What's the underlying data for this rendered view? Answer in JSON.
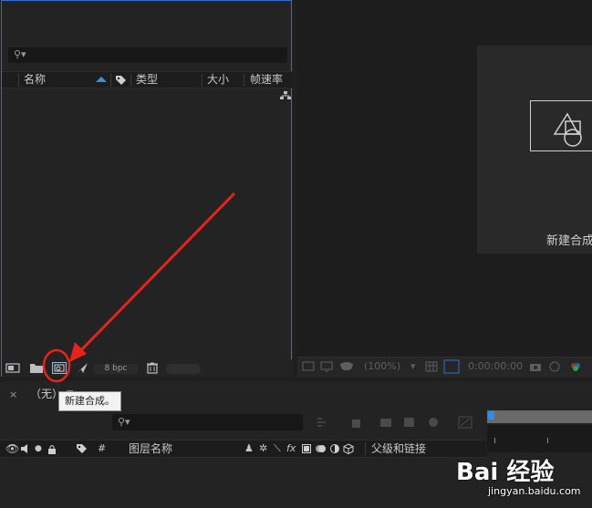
{
  "project_panel": {
    "columns": {
      "name": "名称",
      "type": "类型",
      "size": "大小",
      "frame_rate": "帧速率"
    },
    "footer": {
      "bpc": "8 bpc",
      "buttons": [
        "interpret-footage-icon",
        "new-folder-icon",
        "new-composition-icon",
        "render-queue-icon",
        "trash-icon"
      ]
    }
  },
  "viewer": {
    "placeholder_label": "新建合成",
    "zoom": "(100%)",
    "timecode": "0:00:00:00"
  },
  "timeline": {
    "close": "×",
    "comp_name": "（无）",
    "menu": "≡",
    "tooltip": "新建合成。",
    "columns": {
      "number": "#",
      "layer_name": "图层名称",
      "parent_link": "父级和链接"
    }
  },
  "colors": {
    "accent_blue": "#2f6fd6",
    "annotation_red": "#e8231c",
    "panel_bg": "#232323"
  },
  "watermark": {
    "text": "Bai 经验",
    "url": "jingyan.baidu.com"
  }
}
